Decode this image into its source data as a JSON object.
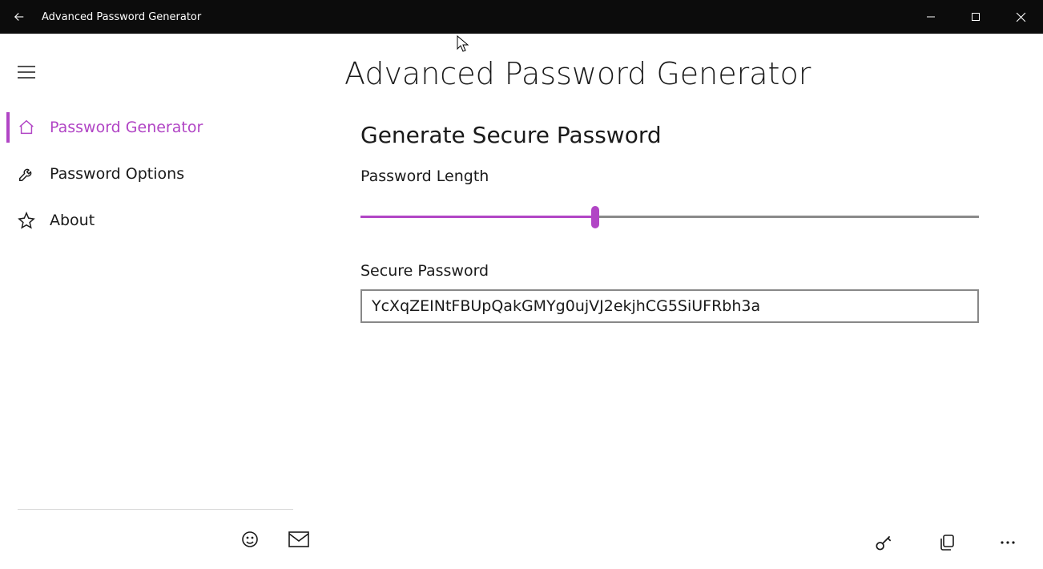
{
  "window": {
    "title": "Advanced Password Generator"
  },
  "sidebar": {
    "items": [
      {
        "label": "Password Generator",
        "active": true
      },
      {
        "label": "Password Options",
        "active": false
      },
      {
        "label": "About",
        "active": false
      }
    ]
  },
  "main": {
    "page_title": "Advanced Password Generator",
    "section_title": "Generate Secure Password",
    "length_label": "Password Length",
    "slider_percent": 38,
    "output_label": "Secure Password",
    "output_value": "YcXqZEINtFBUpQakGMYg0ujVJ2ekjhCG5SiUFRbh3a"
  },
  "colors": {
    "accent": "#b145c5"
  }
}
